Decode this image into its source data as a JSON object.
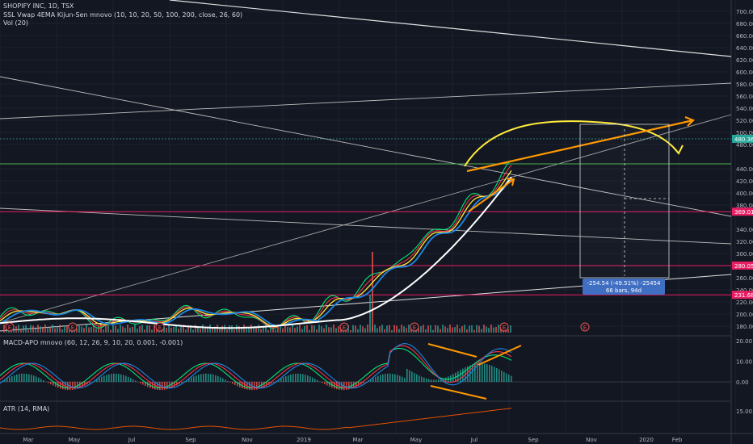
{
  "header": {
    "title": "SHOPIFY INC, 1D, TSX",
    "study1": "SSL Vwap 4EMA Kijun-Sen mnovo (10, 10, 20, 50, 100, 200, close, 26, 60)",
    "study2": "Vol (20)",
    "macd_label": "MACD-APO mnovo (60, 12, 26, 9, 10, 20, 0.001, -0.001)",
    "atr_label": "ATR (14, RMA)"
  },
  "price_axis": {
    "ticks": [
      "700.00",
      "680.00",
      "660.00",
      "640.00",
      "620.00",
      "600.00",
      "580.00",
      "560.00",
      "540.00",
      "520.00",
      "500.00",
      "480.00",
      "440.00",
      "420.00",
      "400.00",
      "380.00",
      "340.00",
      "320.00",
      "300.00",
      "260.00",
      "240.00",
      "220.00",
      "200.00",
      "180.00"
    ],
    "badges": [
      {
        "text": "480.36",
        "color": "#26a69a"
      },
      {
        "text": "369.01",
        "color": "#e91e63"
      },
      {
        "text": "280.05",
        "color": "#e91e63"
      },
      {
        "text": "231.68",
        "color": "#e91e63"
      }
    ]
  },
  "macd_axis": {
    "ticks": [
      "20.00",
      "10.00",
      "0.00"
    ]
  },
  "atr_axis": {
    "ticks": [
      "15.00"
    ]
  },
  "time_axis": {
    "labels": [
      "Mar",
      "May",
      "Jul",
      "Sep",
      "Nov",
      "2019",
      "Mar",
      "May",
      "Jul",
      "Sep",
      "Nov",
      "2020",
      "Feb"
    ]
  },
  "measure": {
    "line1": "-254.54 (-49.51%) -25454",
    "line2": "66 bars, 94d"
  },
  "earnings_marker": "E",
  "colors": {
    "background": "#131722",
    "grid": "#1e2230",
    "price_line": "#00e676",
    "ema_red": "#f23645",
    "ema_yellow": "#ffeb3b",
    "vwap_blue": "#1e88e5",
    "kijun_white": "#ffffff",
    "annotation_orange": "#ff9800",
    "annotation_yellow": "#ffeb3b",
    "horizontal_magenta": "#e91e63",
    "horizontal_green": "#4caf50"
  },
  "chart_data": {
    "type": "line",
    "title": "SHOPIFY INC, 1D, TSX",
    "x": [
      "Mar",
      "May",
      "Jul",
      "Sep",
      "Nov",
      "2019",
      "Mar",
      "May",
      "Jul"
    ],
    "series": [
      {
        "values": [
          178,
          195,
          185,
          200,
          190,
          210,
          205,
          230,
          215,
          200,
          195,
          205,
          220,
          290,
          310,
          380,
          420,
          440,
          460,
          480
        ]
      }
    ],
    "x_labels": [
      "Mar",
      "May",
      "Jul",
      "Sep",
      "Nov",
      "2019",
      "Mar",
      "May",
      "Jul",
      "Sep",
      "Nov",
      "2020",
      "Feb"
    ],
    "ylim": [
      170,
      710
    ],
    "horizontal_levels": [
      448,
      369.01,
      280.05,
      231.68
    ],
    "grid": true
  }
}
